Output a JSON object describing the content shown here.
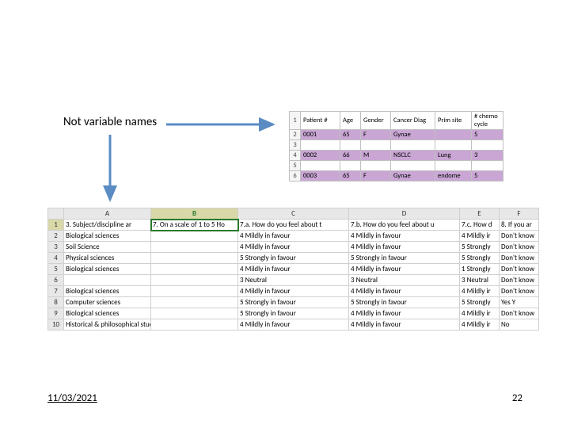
{
  "annotation": "Not variable names",
  "footer": {
    "date": "11/03/2021",
    "page": "22"
  },
  "small_sheet": {
    "cols": [
      "",
      "Patient #",
      "Age",
      "Gender",
      "Cancer Diag",
      "Prim site",
      "# chemo cycle"
    ],
    "rows": [
      {
        "n": "1",
        "hl": false,
        "cells": [
          "Patient #",
          "Age",
          "Gender",
          "Cancer Diag",
          "Prim site",
          "# chemo cycle"
        ]
      },
      {
        "n": "2",
        "hl": true,
        "cells": [
          "0001",
          "65",
          "F",
          "Gynae",
          "",
          "5"
        ]
      },
      {
        "n": "3",
        "hl": false,
        "cells": [
          "",
          "",
          "",
          "",
          "",
          ""
        ]
      },
      {
        "n": "4",
        "hl": true,
        "cells": [
          "0002",
          "66",
          "M",
          "NSCLC",
          "Lung",
          "3"
        ]
      },
      {
        "n": "5",
        "hl": false,
        "cells": [
          "",
          "",
          "",
          "",
          "",
          ""
        ]
      },
      {
        "n": "6",
        "hl": true,
        "cells": [
          "0003",
          "65",
          "F",
          "Gynae",
          "endome",
          "5"
        ]
      }
    ]
  },
  "big_sheet": {
    "cols": [
      "",
      "A",
      "B",
      "C",
      "D",
      "E",
      "F"
    ],
    "header_row": [
      "3. Subject/discipline ar",
      "7. On a scale of 1 to 5 Ho",
      "7.a. How do you feel about t",
      "7.b. How do you feel about u",
      "7.c. How d",
      "8. If you ar"
    ],
    "rows": [
      {
        "n": "2",
        "cells": [
          "Biological sciences",
          "",
          "4 Mildly in favour",
          "4 Mildly in favour",
          "4 Mildly ir",
          "Don't know"
        ]
      },
      {
        "n": "3",
        "cells": [
          "Soil Science",
          "",
          "4 Mildly in favour",
          "4 Mildly in favour",
          "5 Strongly",
          "Don't know"
        ]
      },
      {
        "n": "4",
        "cells": [
          "Physical sciences",
          "",
          "5 Strongly in favour",
          "5 Strongly in favour",
          "5 Strongly",
          "Don't know"
        ]
      },
      {
        "n": "5",
        "cells": [
          "Biological sciences",
          "",
          "4 Mildly in favour",
          "4 Mildly in favour",
          "1 Strongly",
          "Don't know"
        ]
      },
      {
        "n": "6",
        "cells": [
          "",
          "",
          "3 Neutral",
          "3 Neutral",
          "3 Neutral",
          "Don't know"
        ]
      },
      {
        "n": "7",
        "cells": [
          "Biological sciences",
          "",
          "4 Mildly in favour",
          "4 Mildly in favour",
          "4 Mildly ir",
          "Don't know"
        ]
      },
      {
        "n": "8",
        "cells": [
          "Computer sciences",
          "",
          "5 Strongly in favour",
          "5 Strongly in favour",
          "5 Strongly",
          "Yes           Y"
        ]
      },
      {
        "n": "9",
        "cells": [
          "Biological sciences",
          "",
          "5 Strongly in favour",
          "4 Mildly in favour",
          "4 Mildly ir",
          "Don't know"
        ]
      },
      {
        "n": "10",
        "cells": [
          "Historical & philosophical studies",
          "",
          "4 Mildly in favour",
          "4 Mildly in favour",
          "4 Mildly ir",
          "No"
        ]
      }
    ]
  }
}
